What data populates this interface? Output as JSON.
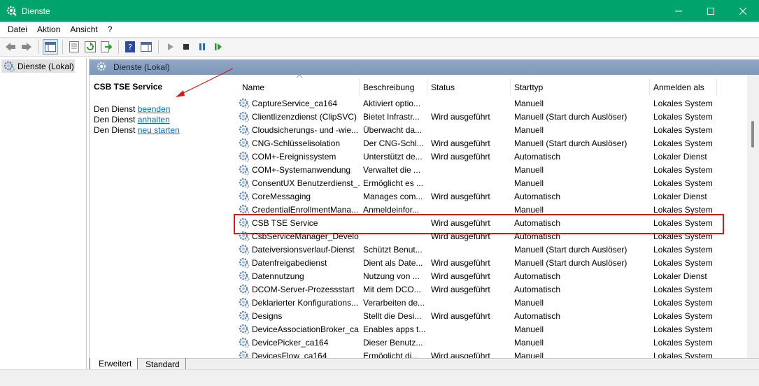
{
  "window": {
    "title": "Dienste"
  },
  "menu": [
    "Datei",
    "Aktion",
    "Ansicht",
    "?"
  ],
  "tree": {
    "root": "Dienste (Lokal)"
  },
  "content": {
    "header": "Dienste (Lokal)"
  },
  "detail": {
    "service_name": "CSB TSE Service",
    "prefix": "Den Dienst",
    "actions": [
      "beenden",
      "anhalten",
      "neu starten"
    ]
  },
  "columns": [
    "Name",
    "Beschreibung",
    "Status",
    "Starttyp",
    "Anmelden als"
  ],
  "rows": [
    [
      "CaptureService_ca164",
      "Aktiviert optio...",
      "",
      "Manuell",
      "Lokales System"
    ],
    [
      "Clientlizenzdienst (ClipSVC)",
      "Bietet Infrastr...",
      "Wird ausgeführt",
      "Manuell (Start durch Auslöser)",
      "Lokales System"
    ],
    [
      "Cloudsicherungs- und -wie...",
      "Überwacht da...",
      "",
      "Manuell",
      "Lokales System"
    ],
    [
      "CNG-Schlüsselisolation",
      "Der CNG-Schl...",
      "Wird ausgeführt",
      "Manuell (Start durch Auslöser)",
      "Lokales System"
    ],
    [
      "COM+-Ereignissystem",
      "Unterstützt de...",
      "Wird ausgeführt",
      "Automatisch",
      "Lokaler Dienst"
    ],
    [
      "COM+-Systemanwendung",
      "Verwaltet die ...",
      "",
      "Manuell",
      "Lokales System"
    ],
    [
      "ConsentUX Benutzerdienst_...",
      "Ermöglicht es ...",
      "",
      "Manuell",
      "Lokales System"
    ],
    [
      "CoreMessaging",
      "Manages com...",
      "Wird ausgeführt",
      "Automatisch",
      "Lokaler Dienst"
    ],
    [
      "CredentialEnrollmentMana...",
      "Anmeldeinfor...",
      "",
      "Manuell",
      "Lokales System"
    ],
    [
      "CSB TSE Service",
      "",
      "Wird ausgeführt",
      "Automatisch",
      "Lokales System"
    ],
    [
      "CsbServiceManager_Develo...",
      "",
      "Wird ausgeführt",
      "Automatisch",
      "Lokales System"
    ],
    [
      "Dateiversionsverlauf-Dienst",
      "Schützt Benut...",
      "",
      "Manuell (Start durch Auslöser)",
      "Lokales System"
    ],
    [
      "Datenfreigabedienst",
      "Dient als Date...",
      "Wird ausgeführt",
      "Manuell (Start durch Auslöser)",
      "Lokales System"
    ],
    [
      "Datennutzung",
      "Nutzung von ...",
      "Wird ausgeführt",
      "Automatisch",
      "Lokaler Dienst"
    ],
    [
      "DCOM-Server-Prozessstart",
      "Mit dem DCO...",
      "Wird ausgeführt",
      "Automatisch",
      "Lokales System"
    ],
    [
      "Deklarierter Konfigurations...",
      "Verarbeiten de...",
      "",
      "Manuell",
      "Lokales System"
    ],
    [
      "Designs",
      "Stellt die Desi...",
      "Wird ausgeführt",
      "Automatisch",
      "Lokales System"
    ],
    [
      "DeviceAssociationBroker_ca...",
      "Enables apps t...",
      "",
      "Manuell",
      "Lokales System"
    ],
    [
      "DevicePicker_ca164",
      "Dieser Benutz...",
      "",
      "Manuell",
      "Lokales System"
    ],
    [
      "DevicesFlow_ca164",
      "Ermöglicht di...",
      "Wird ausgeführt",
      "Manuell",
      "Lokales System"
    ]
  ],
  "highlight_row": 9,
  "tabs": [
    "Erweitert",
    "Standard"
  ],
  "colors": {
    "titlebar": "#00a36c",
    "highlight": "#d01b1b",
    "link": "#0066cc"
  }
}
